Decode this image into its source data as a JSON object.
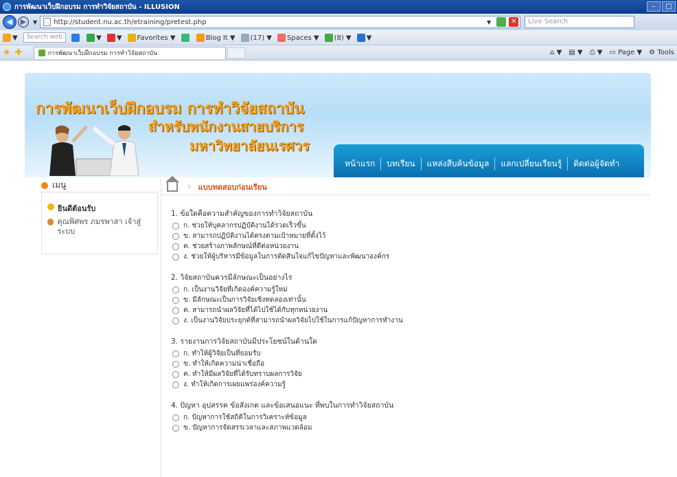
{
  "window": {
    "title": "การพัฒนาเว็บฝึกอบรม การทำวิจัยสถาบัน - ILLUSION",
    "url": "http://student.nu.ac.th/etraining/pretest.php",
    "search_placeholder": "Live Search"
  },
  "toolbar": {
    "search_web_placeholder": "Search web",
    "favorites": "Favorites",
    "blog": "Blog It",
    "mail": "(17)",
    "spaces": "Spaces",
    "count": "(8)"
  },
  "tabs": {
    "active_tab": "การพัฒนาเว็บฝึกอบรม การทำวิจัยสถาบัน",
    "page_menu": "Page",
    "tools_menu": "Tools"
  },
  "header": {
    "line1": "การพัฒนาเว็บฝึกอบรม การทำวิจัยสถาบัน",
    "line2": "สำหรับพนักงานสายบริการ",
    "line3": "มหาวิทยาลัยนเรศวร",
    "nav": [
      "หน้าแรก",
      "บทเรียน",
      "แหล่งสืบค้นข้อมูล",
      "แลกเปลี่ยนเรียนรู้",
      "ติดต่อผู้จัดทำ"
    ]
  },
  "sidebar": {
    "menu_title": "เมนู",
    "welcome": "ยินดีต้อนรับ",
    "user": "คุณพิศพร ภมรพาสา เจ้าสู่ระบบ"
  },
  "main": {
    "breadcrumb": "แบบทดสอบก่อนเรียน",
    "questions": [
      {
        "text": "1. ข้อใดคือความสำคัญของการทำวิจัยสถาบัน",
        "options": [
          "ก.  ช่วยให้บุคลากรปฏิบัติงานได้รวดเร็วขึ้น",
          "ข.  สามารถปฏิบัติงานได้ตรงตามเป้าหมายที่ตั้งไว้",
          "ค.  ช่วยสร้างภาพลักษณ์ที่ดีต่อหน่วยงาน",
          "ง.  ช่วยให้ผู้บริหารมีข้อมูลในการตัดสินใจแก้ไขปัญหาและพัฒนาองค์กร"
        ]
      },
      {
        "text": "2. วิจัยสถาบันควรมีลักษณะเป็นอย่างไร",
        "options": [
          "ก.  เป็นงานวิจัยที่เกิดองค์ความรู้ใหม่",
          "ข.  มีลักษณะเป็นการวิจัยเชิงทดลองเท่านั้น",
          "ค.  สามารถนำผลวิจัยที่ได้ไปใช้ได้กับทุกหน่วยงาน",
          "ง.  เป็นงานวิจัยประยุกต์ที่สามารถนำผลวิจัยไปใช้ในการแก้ปัญหาการทำงาน"
        ]
      },
      {
        "text": "3. รายงานการวิจัยสถาบันมีประโยชน์ในด้านใด",
        "options": [
          "ก.  ทำให้ผู้วิจัยเป็นที่ยอมรับ",
          "ข.  ทำให้เกิดความน่าเชื่อถือ",
          "ค.  ทำให้มีผลวิจัยที่ได้รับทราบผลการวิจัย",
          "ง.  ทำให้เกิดการเผยแพร่องค์ความรู้"
        ]
      },
      {
        "text": "4. ปัญหา อุปสรรค ข้อสังเกต และข้อเสนอแนะ ที่พบในการทำวิจัยสถาบัน",
        "options": [
          "ก.  ปัญหาการใช้สถิติในการวิเคราะห์ข้อมูล",
          "ข.  ปัญหาการจัดสรรเวลาและสภาพแวดล้อม"
        ]
      }
    ]
  }
}
